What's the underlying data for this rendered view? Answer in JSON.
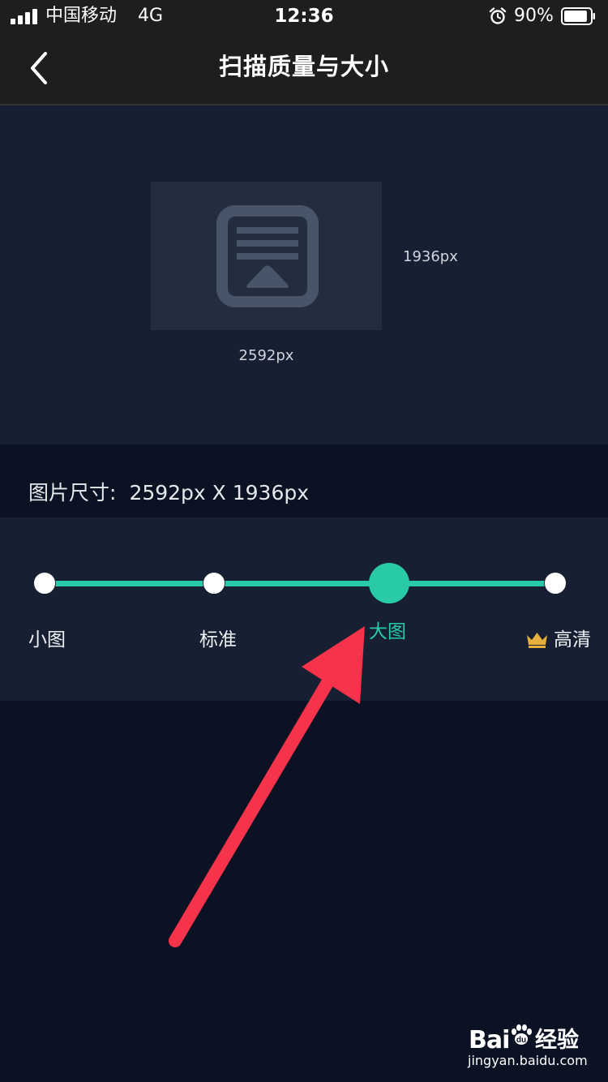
{
  "status_bar": {
    "carrier": "中国移动",
    "network": "4G",
    "time": "12:36",
    "battery_percent": "90%",
    "battery_level": 0.9
  },
  "nav": {
    "title": "扫描质量与大小"
  },
  "preview": {
    "height_label": "1936px",
    "width_label": "2592px"
  },
  "size_info": {
    "label": "图片尺寸:",
    "value": "2592px X 1936px"
  },
  "quality": {
    "selected_index": 2,
    "levels": [
      {
        "label": "小图",
        "premium": false
      },
      {
        "label": "标准",
        "premium": false
      },
      {
        "label": "大图",
        "premium": false
      },
      {
        "label": "高清",
        "premium": true
      }
    ]
  },
  "annotation": {
    "arrow_color": "#f5334a"
  },
  "colors": {
    "accent": "#29cba6",
    "crown": "#e3b03d"
  },
  "watermark": {
    "brand": "Bai",
    "brand_cn": "经验",
    "url": "jingyan.baidu.com"
  }
}
